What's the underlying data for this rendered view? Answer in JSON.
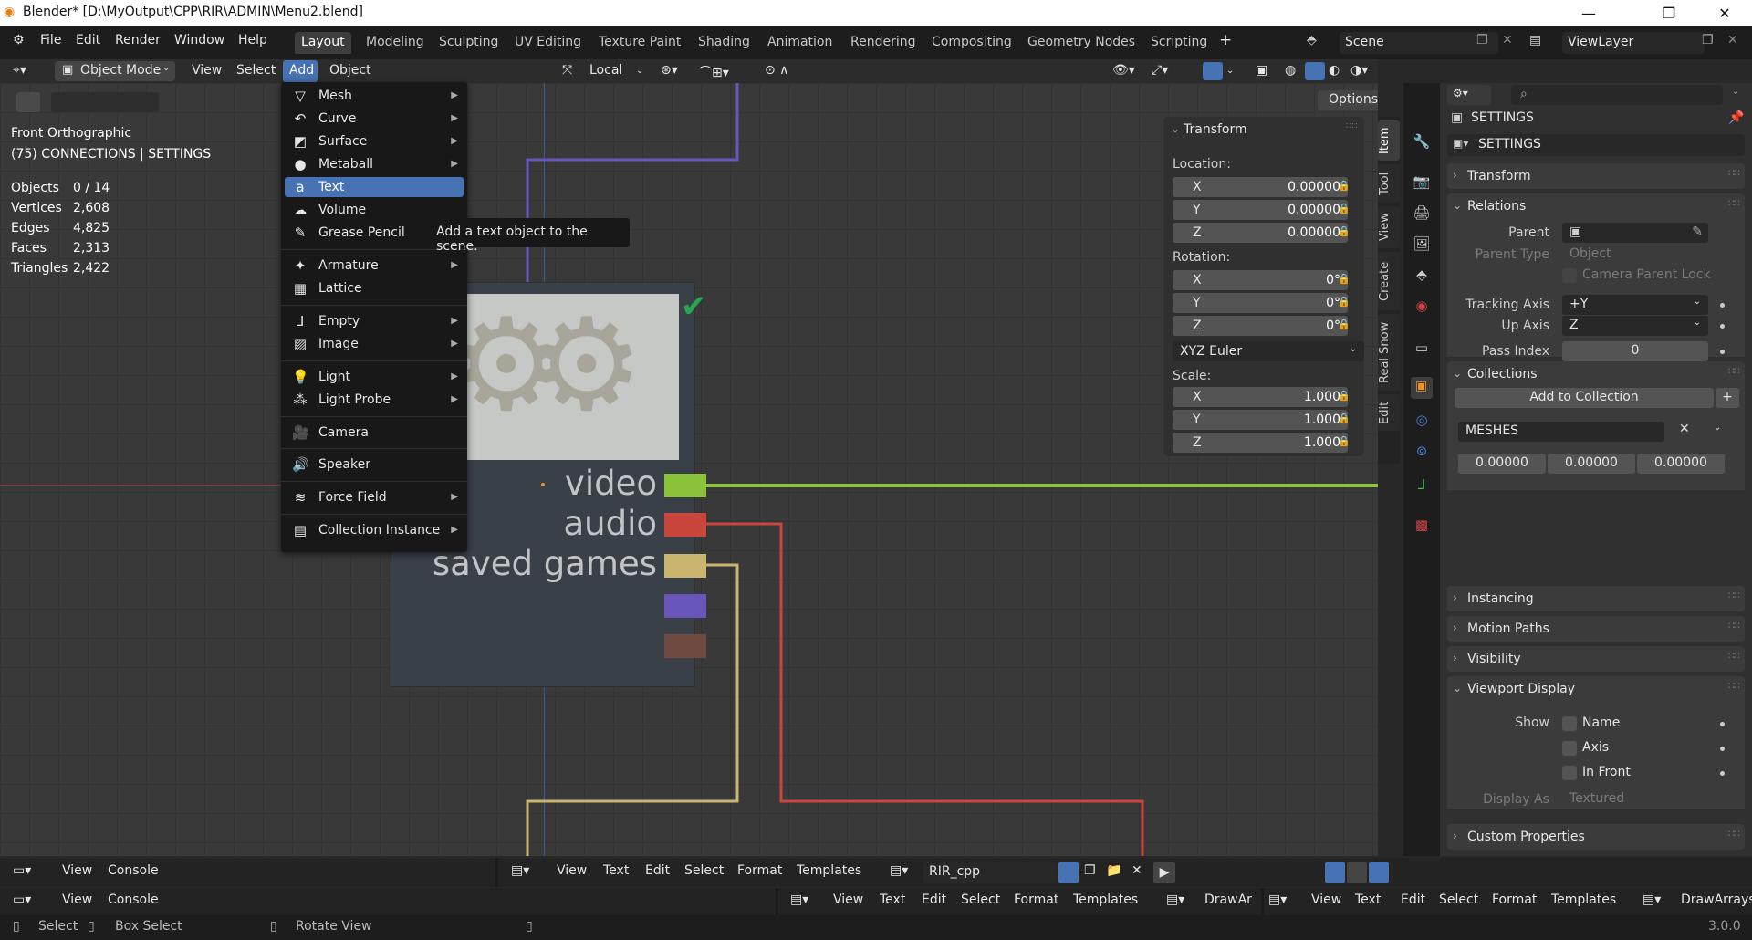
{
  "window": {
    "title": "Blender* [D:\\MyOutput\\CPP\\RIR\\ADMIN\\Menu2.blend]"
  },
  "topmenu": [
    "File",
    "Edit",
    "Render",
    "Window",
    "Help"
  ],
  "workspaces": [
    "Layout",
    "Modeling",
    "Sculpting",
    "UV Editing",
    "Texture Paint",
    "Shading",
    "Animation",
    "Rendering",
    "Compositing",
    "Geometry Nodes",
    "Scripting"
  ],
  "scene": "Scene",
  "view_layer": "ViewLayer",
  "viewport_header": {
    "mode": "Object Mode",
    "menus": [
      "View",
      "Select",
      "Add",
      "Object"
    ],
    "orientation": "Local",
    "options": "Options"
  },
  "viewport_info": {
    "view_name": "Front Orthographic",
    "collection": "(75) CONNECTIONS | SETTINGS",
    "stats": [
      {
        "label": "Objects",
        "value": "0 / 14"
      },
      {
        "label": "Vertices",
        "value": "2,608"
      },
      {
        "label": "Edges",
        "value": "4,825"
      },
      {
        "label": "Faces",
        "value": "2,313"
      },
      {
        "label": "Triangles",
        "value": "2,422"
      }
    ],
    "scene_labels": [
      "video",
      "audio",
      "saved games"
    ]
  },
  "add_menu": {
    "items": [
      {
        "label": "Mesh",
        "icon": "mesh-icon"
      },
      {
        "label": "Curve",
        "icon": "curve-icon"
      },
      {
        "label": "Surface",
        "icon": "surface-icon"
      },
      {
        "label": "Metaball",
        "icon": "metaball-icon"
      },
      {
        "label": "Text",
        "icon": "text-icon"
      },
      {
        "label": "Volume",
        "icon": "volume-icon"
      },
      {
        "label": "Grease Pencil",
        "icon": "grease-pencil-icon"
      },
      {
        "label": "Armature",
        "icon": "armature-icon"
      },
      {
        "label": "Lattice",
        "icon": "lattice-icon"
      },
      {
        "label": "Empty",
        "icon": "empty-icon"
      },
      {
        "label": "Image",
        "icon": "image-icon"
      },
      {
        "label": "Light",
        "icon": "light-icon"
      },
      {
        "label": "Light Probe",
        "icon": "light-probe-icon"
      },
      {
        "label": "Camera",
        "icon": "camera-icon"
      },
      {
        "label": "Speaker",
        "icon": "speaker-icon"
      },
      {
        "label": "Force Field",
        "icon": "force-field-icon"
      },
      {
        "label": "Collection Instance",
        "icon": "collection-instance-icon"
      }
    ],
    "tooltip": "Add a text object to the scene."
  },
  "transform_panel": {
    "title": "Transform",
    "location_label": "Location:",
    "location": [
      {
        "axis": "X",
        "value": "0.00000"
      },
      {
        "axis": "Y",
        "value": "0.00000"
      },
      {
        "axis": "Z",
        "value": "0.00000"
      }
    ],
    "rotation_label": "Rotation:",
    "rotation": [
      {
        "axis": "X",
        "value": "0°"
      },
      {
        "axis": "Y",
        "value": "0°"
      },
      {
        "axis": "Z",
        "value": "0°"
      }
    ],
    "rotation_mode": "XYZ Euler",
    "scale_label": "Scale:",
    "scale": [
      {
        "axis": "X",
        "value": "1.000"
      },
      {
        "axis": "Y",
        "value": "1.000"
      },
      {
        "axis": "Z",
        "value": "1.000"
      }
    ]
  },
  "side_tabs": [
    "Item",
    "Tool",
    "View",
    "Create",
    "Real Snow",
    "Edit"
  ],
  "properties": {
    "object_name": "SETTINGS",
    "object_field": "SETTINGS",
    "sections": {
      "transform": "Transform",
      "relations": "Relations",
      "collections": "Collections",
      "instancing": "Instancing",
      "motion_paths": "Motion Paths",
      "visibility": "Visibility",
      "viewport_display": "Viewport Display",
      "custom_properties": "Custom Properties"
    },
    "relations": {
      "parent_label": "Parent",
      "parent_type_label": "Parent Type",
      "parent_type_value": "Object",
      "camera_parent_lock": "Camera Parent Lock",
      "tracking_axis_label": "Tracking Axis",
      "tracking_axis_value": "+Y",
      "up_axis_label": "Up Axis",
      "up_axis_value": "Z",
      "pass_index_label": "Pass Index",
      "pass_index_value": "0"
    },
    "collections": {
      "add_button": "Add to Collection",
      "name": "MESHES",
      "offset": [
        "0.00000",
        "0.00000",
        "0.00000"
      ]
    },
    "viewport_display": {
      "show_label": "Show",
      "name": "Name",
      "axis": "Axis",
      "in_front": "In Front",
      "display_as_label": "Display As",
      "display_as_value": "Textured"
    }
  },
  "bottom_row1": {
    "console_menus": [
      "View",
      "Console"
    ],
    "text_menus": [
      "View",
      "Text",
      "Edit",
      "Select",
      "Format",
      "Templates"
    ],
    "text_file": "RIR_cpp"
  },
  "bottom_row2": {
    "console_menus": [
      "View",
      "Console"
    ],
    "text_menus": [
      "View",
      "Text",
      "Edit",
      "Select",
      "Format",
      "Templates"
    ],
    "text_file": "DrawAr",
    "text_menus2": [
      "View",
      "Text",
      "Edit",
      "Select",
      "Format",
      "Templates"
    ],
    "text_file2": "DrawArrays"
  },
  "status_bar": {
    "select": "Select",
    "box_select": "Box Select",
    "rotate_view": "Rotate View",
    "version": "3.0.0"
  },
  "colors": {
    "accent": "#4772b3",
    "green_wire": "#8bc33a",
    "red_wire": "#c9463d",
    "yellow_wire": "#c9b56e",
    "purple_wire": "#6a55bd"
  }
}
